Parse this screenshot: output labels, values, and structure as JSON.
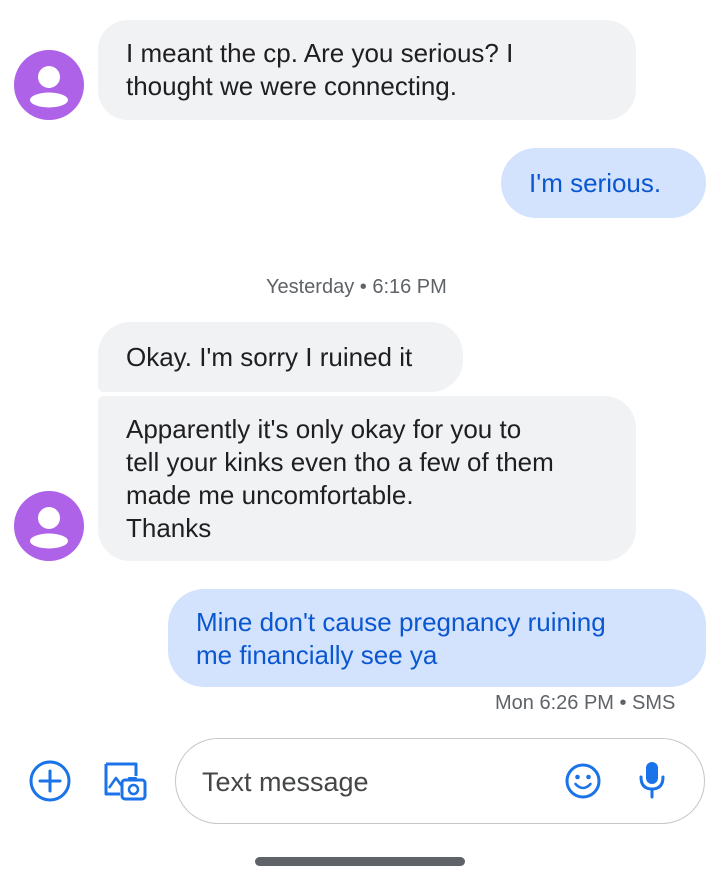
{
  "messages": {
    "m1": "I meant the cp. Are you serious? I\nthought we were connecting.",
    "m2": "I'm serious.",
    "separator": "Yesterday • 6:16 PM",
    "m3": "Okay. I'm sorry I ruined it",
    "m4": "Apparently it's only okay for you to\ntell your kinks even tho a few of them\nmade me uncomfortable.\nThanks",
    "m5": "Mine don't cause pregnancy ruining\nme financially see ya",
    "status": "Mon 6:26 PM • SMS"
  },
  "compose": {
    "placeholder": "Text message"
  },
  "icons": {
    "avatar": "person-icon",
    "add": "add-circle-icon",
    "gallery": "gallery-camera-icon",
    "emoji": "emoji-icon",
    "mic": "mic-icon"
  },
  "colors": {
    "incoming_bubble": "#f1f2f4",
    "outgoing_bubble": "#d3e3fd",
    "outgoing_text": "#0b57d0",
    "avatar": "#ae62e8",
    "accent": "#1a73e8"
  }
}
